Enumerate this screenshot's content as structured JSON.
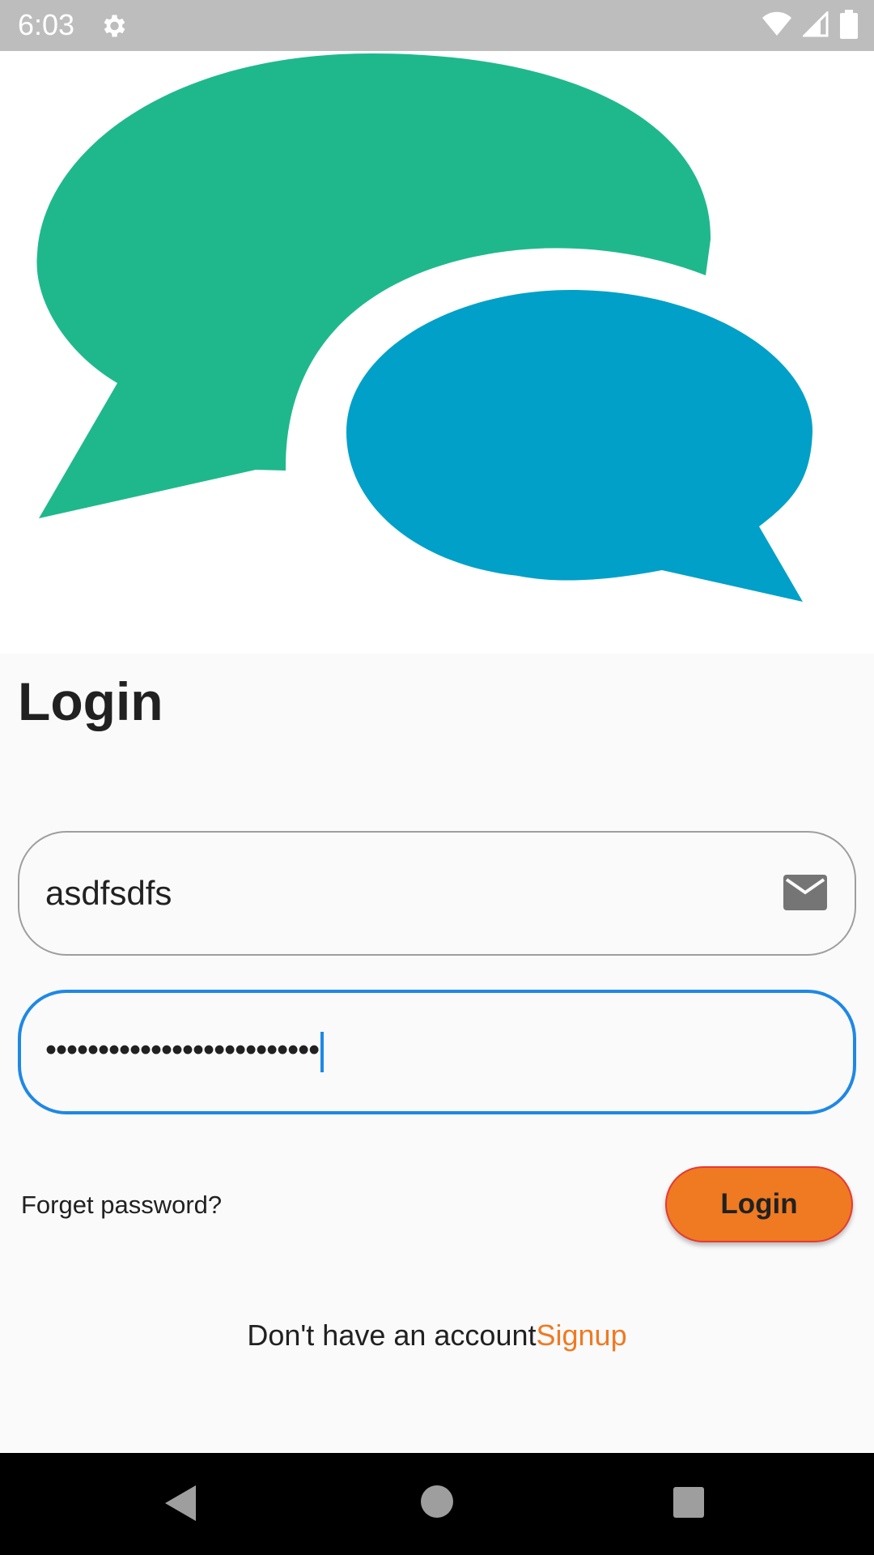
{
  "status_bar": {
    "time": "6:03",
    "icons": [
      "gear-icon",
      "wifi-icon",
      "signal-icon",
      "battery-icon"
    ]
  },
  "logo": {
    "icons": [
      "chat-bubbles-logo"
    ],
    "colors": {
      "green_bubble": "#1fb88c",
      "blue_bubble": "#00a0c8"
    }
  },
  "page": {
    "title": "Login"
  },
  "email_field": {
    "value": "asdfsdfs",
    "icon": "mail-icon"
  },
  "password_field": {
    "value": "••••••••••••••••••••••••••"
  },
  "actions": {
    "forget_password": "Forget password?",
    "login_button": "Login"
  },
  "signup": {
    "prompt": "Don't have an account",
    "link": "Signup"
  },
  "nav_bar": {
    "icons": [
      "back-icon",
      "home-icon",
      "recent-apps-icon"
    ]
  },
  "colors": {
    "accent": "#ef7a22",
    "focus": "#1e88e5",
    "status_bar": "#bdbdbd"
  }
}
